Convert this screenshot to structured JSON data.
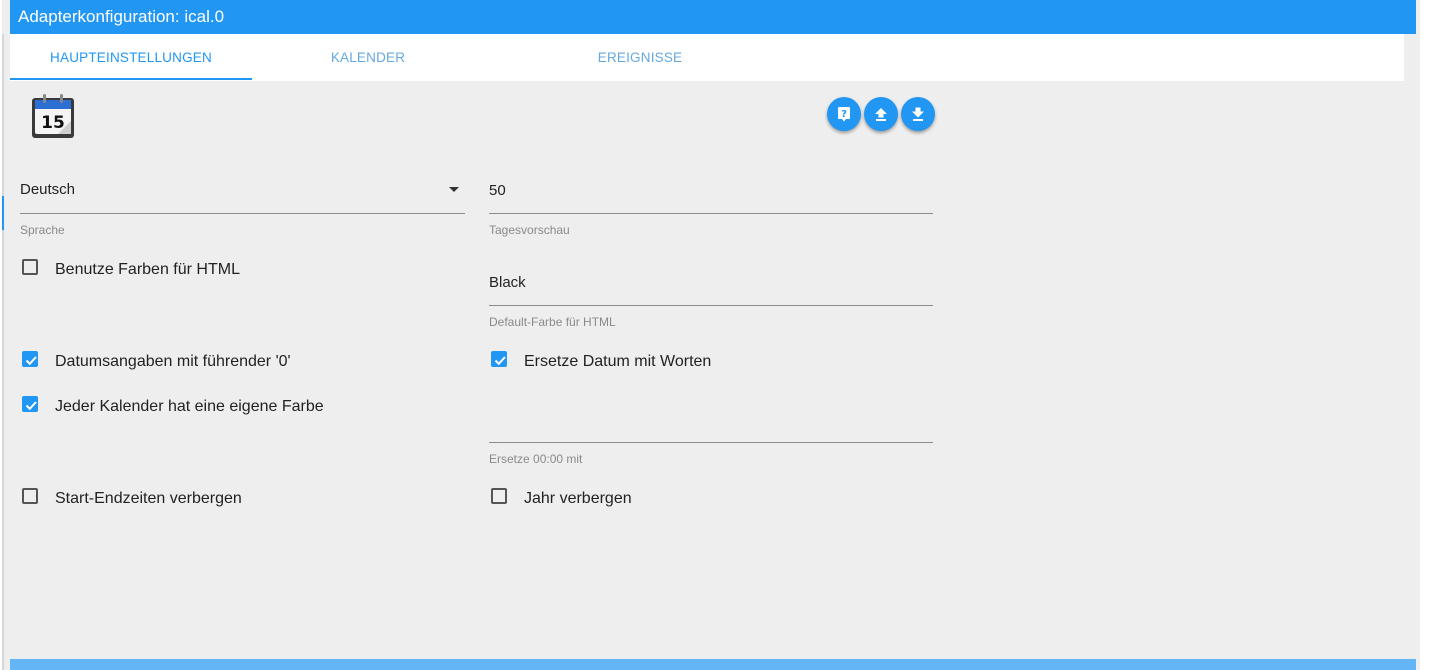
{
  "window": {
    "title": "Adapterkonfiguration: ical.0"
  },
  "tabs": [
    {
      "label": "HAUPTEINSTELLUNGEN",
      "active": true
    },
    {
      "label": "KALENDER",
      "active": false
    },
    {
      "label": "EREIGNISSE",
      "active": false
    }
  ],
  "logo": {
    "icon": "calendar-icon",
    "day": "15"
  },
  "toolbar": {
    "help_icon": "help-icon",
    "upload_icon": "upload-icon",
    "download_icon": "download-icon"
  },
  "fields": {
    "language": {
      "value": "Deutsch",
      "label": "Sprache"
    },
    "days_preview": {
      "value": "50",
      "label": "Tagesvorschau"
    },
    "default_color": {
      "value": "Black",
      "label": "Default-Farbe für HTML"
    },
    "replace_midnight": {
      "value": "",
      "label": "Ersetze 00:00 mit"
    }
  },
  "checkboxes": {
    "use_colors": {
      "label": "Benutze Farben für HTML",
      "checked": false
    },
    "leading_zero": {
      "label": "Datumsangaben mit führender '0'",
      "checked": true
    },
    "replace_date": {
      "label": "Ersetze Datum mit Worten",
      "checked": true
    },
    "own_color": {
      "label": "Jeder Kalender hat eine eigene Farbe",
      "checked": true
    },
    "hide_times": {
      "label": "Start-Endzeiten verbergen",
      "checked": false
    },
    "hide_year": {
      "label": "Jahr verbergen",
      "checked": false
    }
  },
  "colors": {
    "accent": "#2196f3",
    "background": "#eeeeee"
  }
}
